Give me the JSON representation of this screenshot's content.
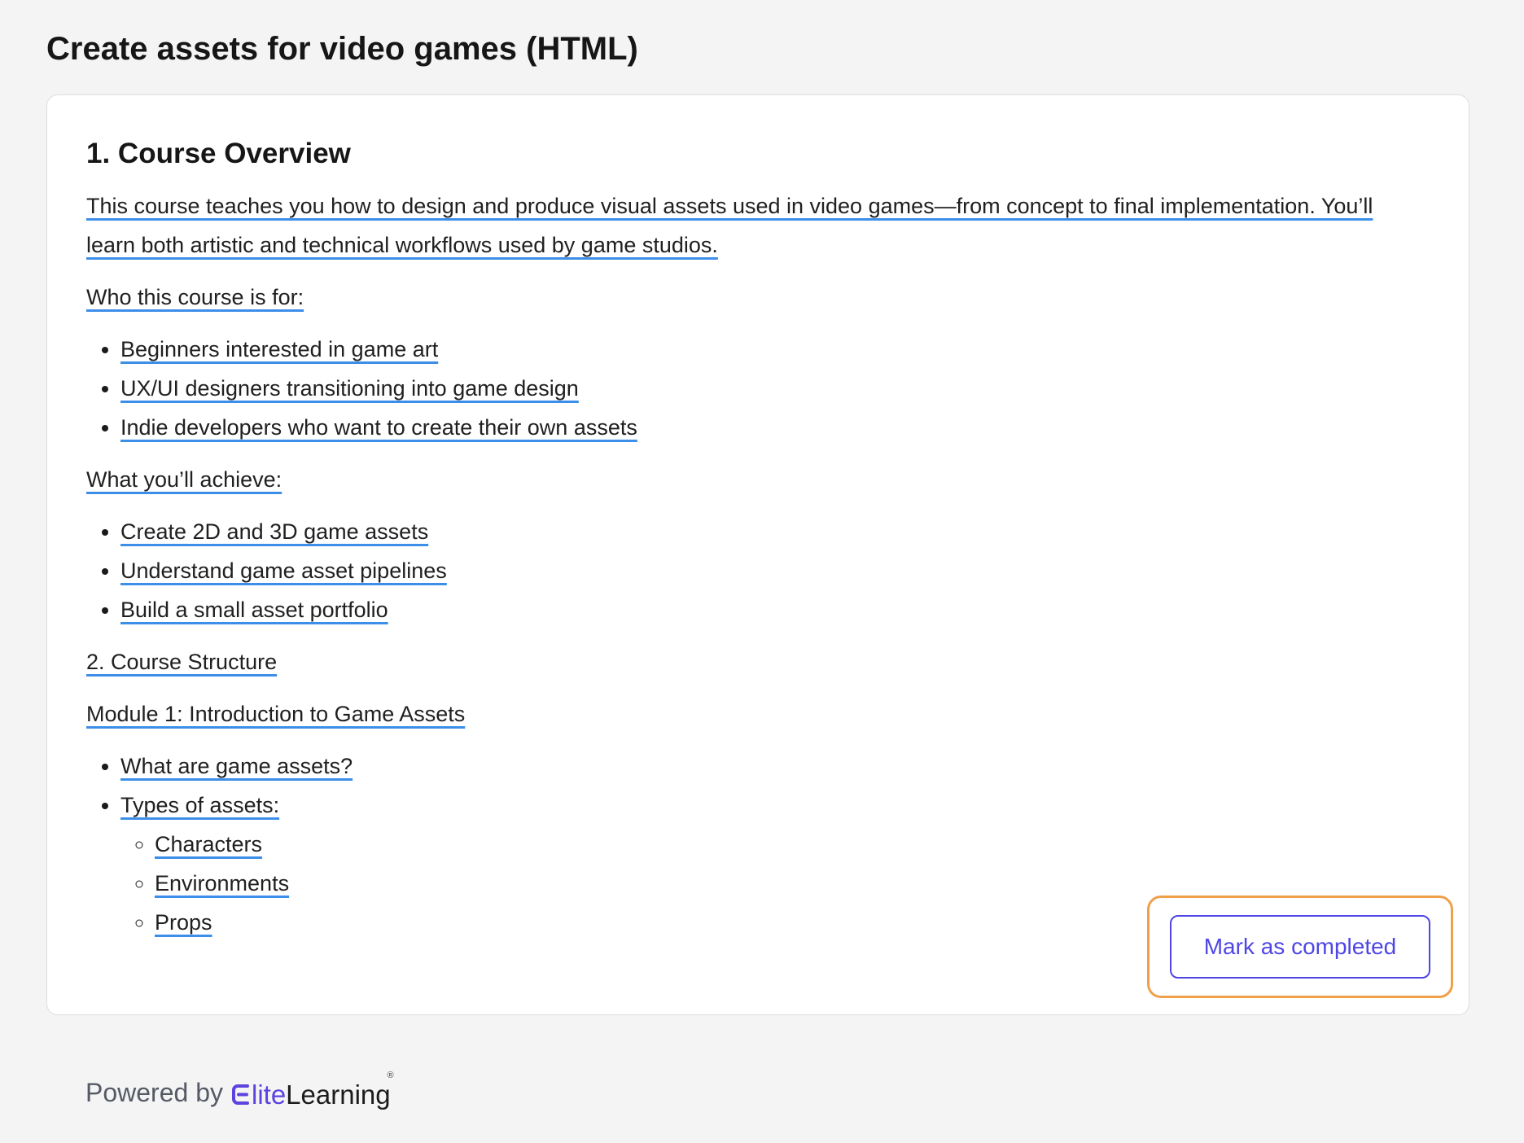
{
  "page": {
    "title": "Create assets for video games (HTML)"
  },
  "course": {
    "heading": "1. Course Overview",
    "intro": "This course teaches you how to design and produce visual assets used in video games—from concept to final implementation. You’ll learn both artistic and technical workflows used by game studios.",
    "audience_label": "Who this course is for:",
    "audience": [
      "Beginners interested in game art",
      "UX/UI designers transitioning into game design",
      "Indie developers who want to create their own assets"
    ],
    "achieve_label": "What you’ll achieve:",
    "achievements": [
      "Create 2D and 3D game assets",
      "Understand game asset pipelines",
      "Build a small asset portfolio"
    ],
    "structure_heading": "2. Course Structure",
    "module1": {
      "title": "Module 1: Introduction to Game Assets",
      "item1": "What are game assets?",
      "item2": "Types of assets:",
      "types": [
        "Characters",
        "Environments",
        "Props"
      ]
    }
  },
  "actions": {
    "mark_completed": "Mark as completed"
  },
  "footer": {
    "powered_by": "Powered by",
    "brand_lite": "lite",
    "brand_learning": "Learning",
    "registered": "®",
    "brand_color": "#5b43e0"
  },
  "colors": {
    "underline": "#3d8ee8",
    "button": "#4f46e5",
    "focus_ring": "#f0a04a"
  }
}
